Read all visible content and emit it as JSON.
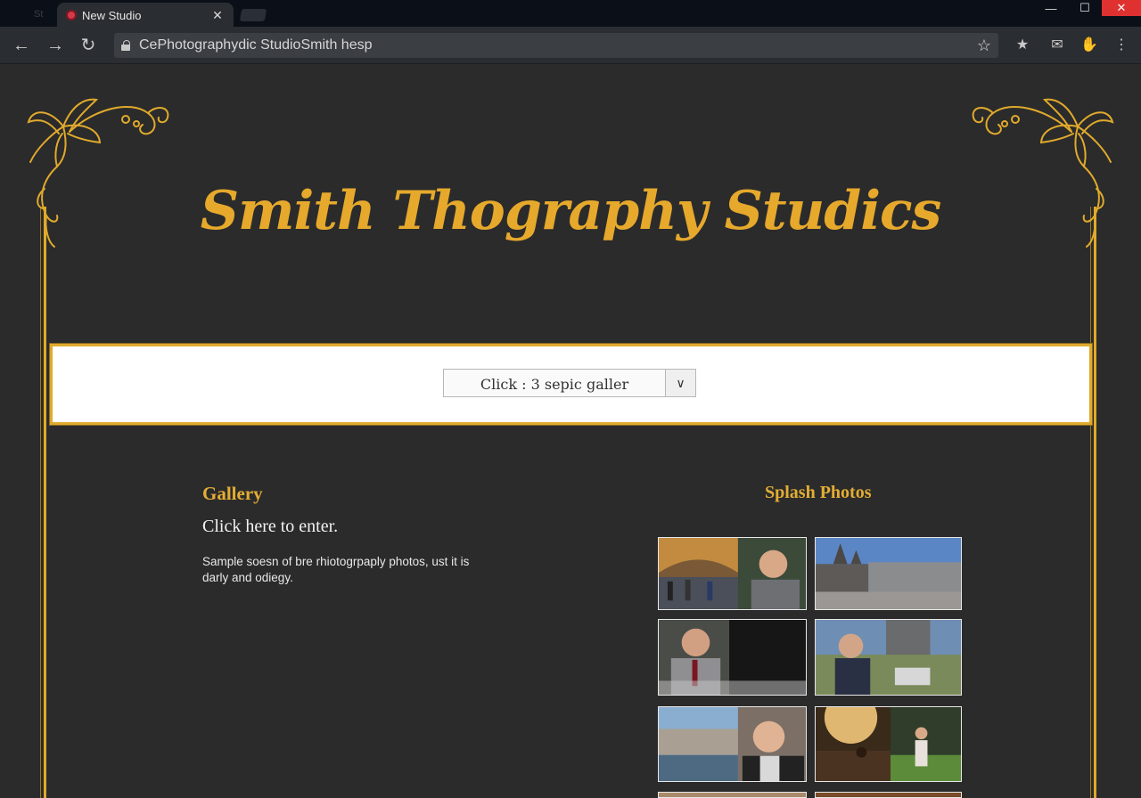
{
  "browser": {
    "tab_title": "New Studio",
    "tab_ghost": "St",
    "url": "CePhotographydic StudioSmith hesp",
    "window_controls": [
      "—",
      "☐",
      "✕"
    ]
  },
  "site": {
    "title": "Smith Thography Studics",
    "gallery_select": {
      "value": "Click : 3 sepic galler"
    }
  },
  "gallery": {
    "heading": "Gallery",
    "enter_link": "Click here to enter.",
    "description": "Sample soesn of bre rhiotogrpaply photos, ust it is darly and odiegy."
  },
  "splash": {
    "heading": "Splash Photos",
    "photos": [
      "portrait-crowd-photo",
      "cathedral-street-photo",
      "man-in-suit-photo",
      "man-with-cap-photo",
      "smiling-man-harbor-photo",
      "sunset-couple-photo",
      "partial-photo-1",
      "partial-photo-2"
    ]
  },
  "colors": {
    "accent_gold": "#e0aa2c",
    "page_bg": "#2b2b2b"
  }
}
